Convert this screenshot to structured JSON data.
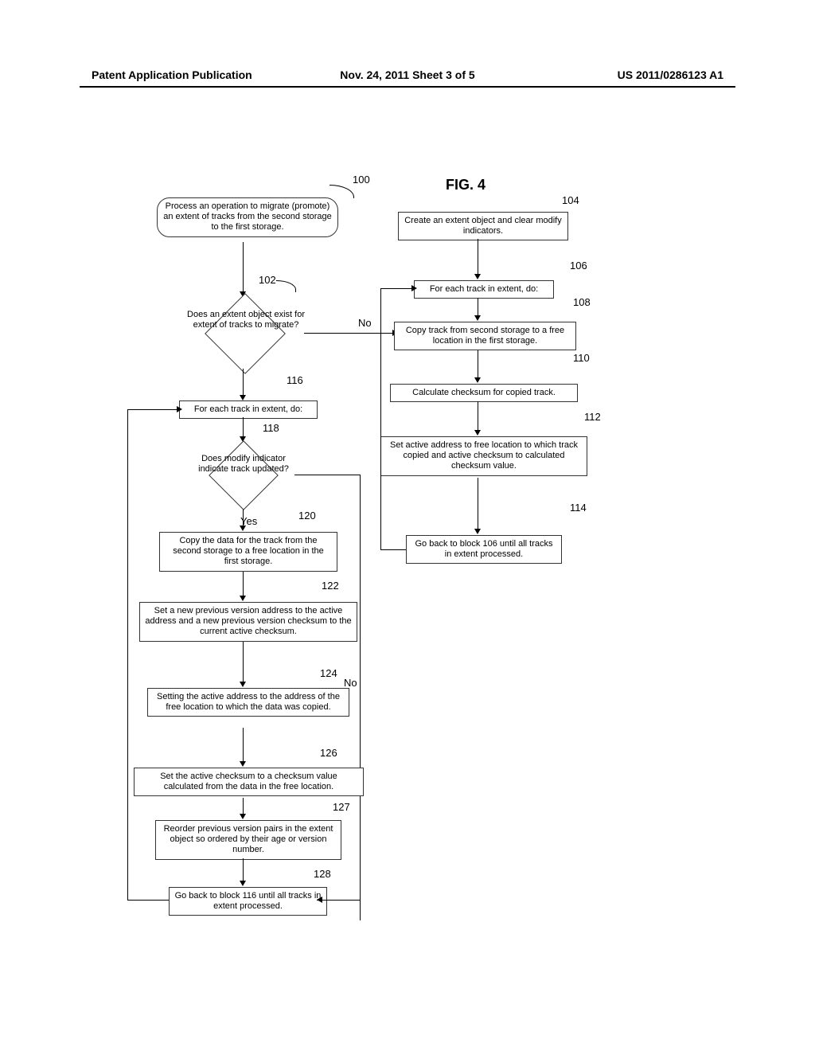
{
  "header": {
    "left": "Patent Application Publication",
    "middle": "Nov. 24, 2011  Sheet 3 of 5",
    "right": "US 2011/0286123 A1"
  },
  "figure_title": "FIG. 4",
  "refs": {
    "r100": "100",
    "r102": "102",
    "r104": "104",
    "r106": "106",
    "r108": "108",
    "r110": "110",
    "r112": "112",
    "r114": "114",
    "r116": "116",
    "r118": "118",
    "r120": "120",
    "r122": "122",
    "r124": "124",
    "r126": "126",
    "r127": "127",
    "r128": "128"
  },
  "labels": {
    "no": "No",
    "yes": "Yes"
  },
  "blocks": {
    "b100": "Process an operation to migrate (promote) an extent of tracks from the second storage to the first storage.",
    "b102": "Does an extent object exist for extent of tracks to migrate?",
    "b104": "Create an extent object and clear modify indicators.",
    "b106": "For each track in extent, do:",
    "b108": "Copy track from second storage to a free location in the first storage.",
    "b110": "Calculate checksum for copied track.",
    "b112": "Set active address to free location to which track copied and active checksum to calculated checksum value.",
    "b114": "Go back to block 106 until all tracks in extent processed.",
    "b116": "For each track in extent, do:",
    "b118": "Does modify indicator indicate track updated?",
    "b120": "Copy the data for the track from the second storage to a free location in the first storage.",
    "b122": "Set a new previous version address to the active address and a new previous version checksum to the current active checksum.",
    "b124": "Setting the active address to the address of the free location to which the data was copied.",
    "b126": "Set the active checksum to a checksum value calculated from the data in the free location.",
    "b127": "Reorder previous version pairs in the extent object so ordered by their age or version number.",
    "b128": "Go back to block 116 until all tracks in extent processed."
  }
}
